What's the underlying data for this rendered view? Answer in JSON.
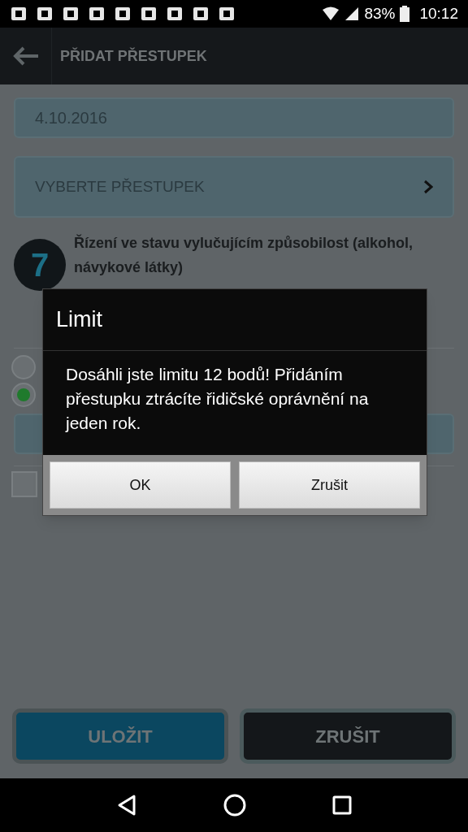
{
  "status_bar": {
    "battery": "83%",
    "time": "10:12"
  },
  "app_bar": {
    "title": "PŘIDAT PŘESTUPEK"
  },
  "date_field": {
    "value": "4.10.2016"
  },
  "offense_select": {
    "label": "VYBERTE PŘESTUPEK"
  },
  "offense": {
    "points": "7",
    "title": "Řízení ve stavu vylučujícím způsobilost (alkohol, návykové látky)"
  },
  "procedure_options": [
    {
      "selected": false
    },
    {
      "selected": true
    }
  ],
  "checkbox": {
    "checked": false
  },
  "buttons": [
    {
      "label": "ULOŽIT",
      "kind": "primary"
    },
    {
      "label": "ZRUŠIT",
      "kind": "secondary"
    }
  ],
  "dialog": {
    "title": "Limit",
    "message": "Dosáhli jste limitu 12 bodů! Přidáním přestupku ztrácíte řidičské oprávnění na jeden rok.",
    "buttons": [
      "OK",
      "Zrušit"
    ]
  }
}
